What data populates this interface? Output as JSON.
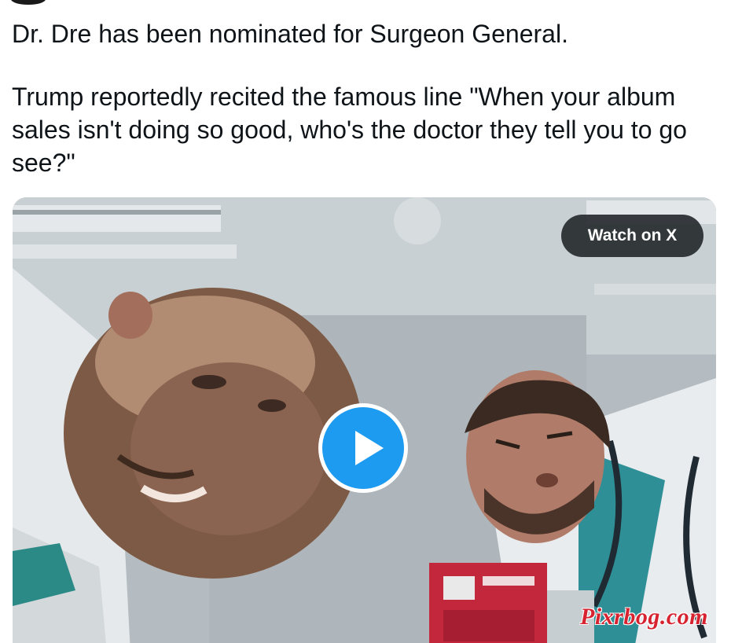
{
  "tweet": {
    "line1": "Dr. Dre has been nominated for Surgeon General.",
    "line2": "Trump reportedly recited the famous line \"When your album sales isn't doing so good, who's the doctor they tell you to go see?\""
  },
  "media": {
    "watch_label": "Watch on X",
    "play_icon": "play-icon",
    "watermark": "Pixrbog.com",
    "accent_color": "#1d9bf0",
    "watermark_color": "#d6232f"
  }
}
